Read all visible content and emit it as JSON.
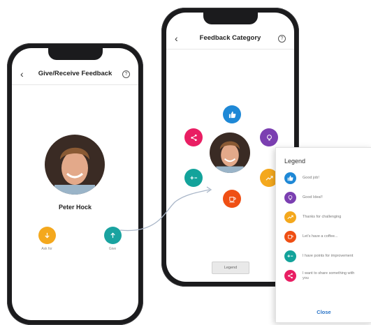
{
  "left_screen": {
    "title": "Give/Receive Feedback",
    "back_icon": "chevron-left-icon",
    "help_icon": "question-circle-icon",
    "person_name": "Peter Hock",
    "ask_label": "Ask for",
    "give_label": "Give",
    "ask_color": "#f4a81d",
    "give_color": "#1aa3a0"
  },
  "right_screen": {
    "title": "Feedback Category",
    "back_icon": "chevron-left-icon",
    "help_icon": "question-circle-icon",
    "legend_button": "Legend",
    "categories": [
      {
        "icon": "thumbs-up-icon",
        "color": "#1e88d6"
      },
      {
        "icon": "lightbulb-icon",
        "color": "#7b3fb1"
      },
      {
        "icon": "trend-up-icon",
        "color": "#f4a81d"
      },
      {
        "icon": "coffee-icon",
        "color": "#ef4f14"
      },
      {
        "icon": "plus-minus-icon",
        "color": "#13a39b"
      },
      {
        "icon": "share-icon",
        "color": "#e91e63"
      }
    ]
  },
  "legend": {
    "title": "Legend",
    "items": [
      {
        "label": "Good job!",
        "icon": "thumbs-up-icon",
        "color": "#1e88d6"
      },
      {
        "label": "Good Idea!!",
        "icon": "lightbulb-icon",
        "color": "#7b3fb1"
      },
      {
        "label": "Thanks for challenging",
        "icon": "trend-up-icon",
        "color": "#f4a81d"
      },
      {
        "label": "Let's have a coffee...",
        "icon": "coffee-icon",
        "color": "#ef4f14"
      },
      {
        "label": "I have points for improvement",
        "icon": "plus-minus-icon",
        "color": "#13a39b"
      },
      {
        "label": "I want to share something with you",
        "icon": "share-icon",
        "color": "#e91e63"
      }
    ],
    "close_label": "Close"
  }
}
